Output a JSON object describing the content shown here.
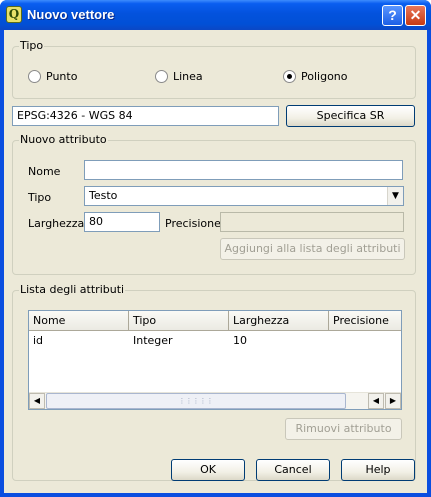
{
  "window": {
    "title": "Nuovo vettore",
    "app_icon": "qgis-icon"
  },
  "tipo": {
    "group_title": "Tipo",
    "options": [
      {
        "label": "Punto",
        "checked": false
      },
      {
        "label": "Linea",
        "checked": false
      },
      {
        "label": "Poligono",
        "checked": true
      }
    ]
  },
  "crs": {
    "value": "EPSG:4326 - WGS 84",
    "button_label": "Specifica SR"
  },
  "new_attribute": {
    "group_title": "Nuovo attributo",
    "nome_label": "Nome",
    "nome_value": "",
    "tipo_label": "Tipo",
    "tipo_value": "Testo",
    "larghezza_label": "Larghezza",
    "larghezza_value": "80",
    "precisione_label": "Precisione",
    "precisione_value": "",
    "add_button": "Aggiungi alla lista degli attributi"
  },
  "attribute_list": {
    "group_title": "Lista degli attributi",
    "columns": [
      "Nome",
      "Tipo",
      "Larghezza",
      "Precisione"
    ],
    "rows": [
      [
        "id",
        "Integer",
        "10",
        ""
      ]
    ],
    "remove_button": "Rimuovi attributo"
  },
  "footer": {
    "ok": "OK",
    "cancel": "Cancel",
    "help": "Help"
  }
}
